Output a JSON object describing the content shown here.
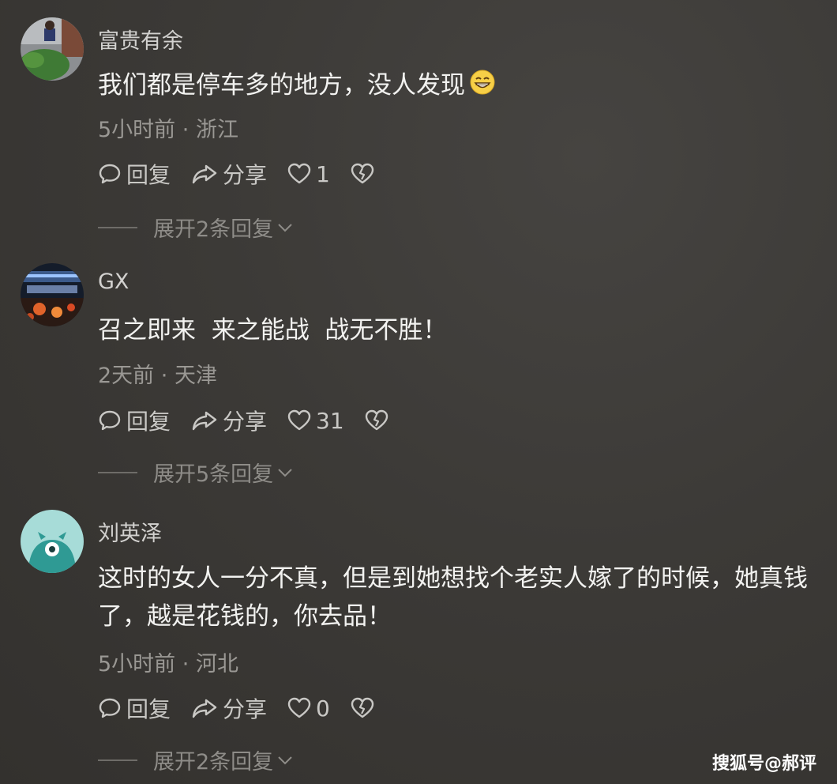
{
  "comments": [
    {
      "username": "富贵有余",
      "text": "我们都是停车多的地方，没人发现",
      "emoji": "😁",
      "time": "5小时前",
      "location": "浙江",
      "reply_label": "回复",
      "share_label": "分享",
      "likes": "1",
      "expand_label": "展开2条回复"
    },
    {
      "username": "GX",
      "text": "召之即来  来之能战  战无不胜！",
      "time": "2天前",
      "location": "天津",
      "reply_label": "回复",
      "share_label": "分享",
      "likes": "31",
      "expand_label": "展开5条回复"
    },
    {
      "username": "刘英泽",
      "text": "这时的女人一分不真，但是到她想找个老实人嫁了的时候，她真钱了，越是花钱的，你去品！",
      "time": "5小时前",
      "location": "河北",
      "reply_label": "回复",
      "share_label": "分享",
      "likes": "0",
      "expand_label": "展开2条回复"
    }
  ],
  "separator": "·",
  "watermark": "搜狐号@郝评",
  "icons": [
    "comment-bubble-icon",
    "share-arrow-icon",
    "heart-icon",
    "broken-heart-icon",
    "chevron-down-icon"
  ]
}
